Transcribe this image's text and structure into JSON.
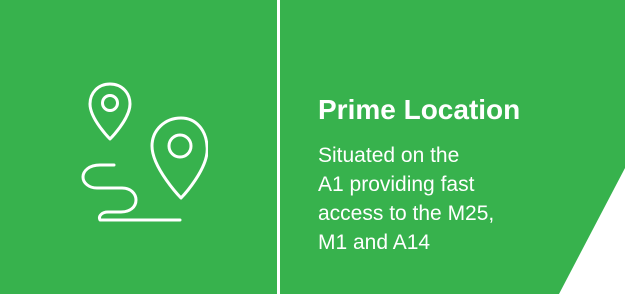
{
  "colors": {
    "tile_background": "#37b24d",
    "foreground": "#ffffff"
  },
  "feature": {
    "icon": "map-pins-route-icon",
    "title": "Prime Location",
    "description_lines": [
      "Situated on the",
      "A1 providing fast",
      "access to the M25,",
      "M1 and A14"
    ]
  }
}
